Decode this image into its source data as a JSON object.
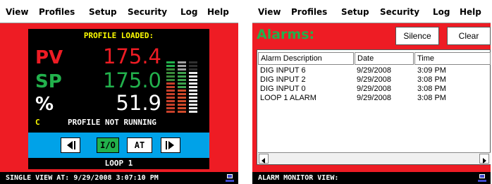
{
  "menu_items": [
    "View",
    "Profiles",
    "Setup",
    "Security",
    "Log",
    "Help"
  ],
  "single_view": {
    "banner": "PROFILE LOADED:",
    "pv": {
      "label": "PV",
      "value": "175.4"
    },
    "sp": {
      "label": "SP",
      "value": "175.0"
    },
    "output": {
      "label": "%",
      "value": "51.9"
    },
    "c_label": "C",
    "profile_status": "PROFILE NOT RUNNING",
    "nav": {
      "io_label": "I/O",
      "at_label": "AT"
    },
    "loop_label": "LOOP 1",
    "status_bar": "SINGLE VIEW AT:  9/29/2008 3:07:10 PM"
  },
  "alarm_view": {
    "title": "Alarms:",
    "silence_label": "Silence",
    "clear_label": "Clear",
    "columns": [
      "Alarm Description",
      "Date",
      "Time"
    ],
    "rows": [
      [
        "DIG INPUT 6",
        "9/29/2008",
        "3:09 PM"
      ],
      [
        "DIG INPUT 2",
        "9/29/2008",
        "3:08 PM"
      ],
      [
        "DIG INPUT 0",
        "9/29/2008",
        "3:08 PM"
      ],
      [
        "LOOP 1 ALARM",
        "9/29/2008",
        "3:08 PM"
      ]
    ],
    "status_bar": "ALARM MONITOR VIEW:"
  },
  "icons": [
    "left-arrow-icon",
    "right-arrow-icon",
    "scroll-left-icon",
    "scroll-right-icon",
    "network-icon"
  ],
  "colors": {
    "frame": "#ee1c24",
    "pv": "#ee1c24",
    "sp": "#22b14c",
    "banner": "#ffff00",
    "nav_bar": "#00a2e8",
    "io_button": "#22b14c",
    "alarms_title": "#22b14c"
  }
}
